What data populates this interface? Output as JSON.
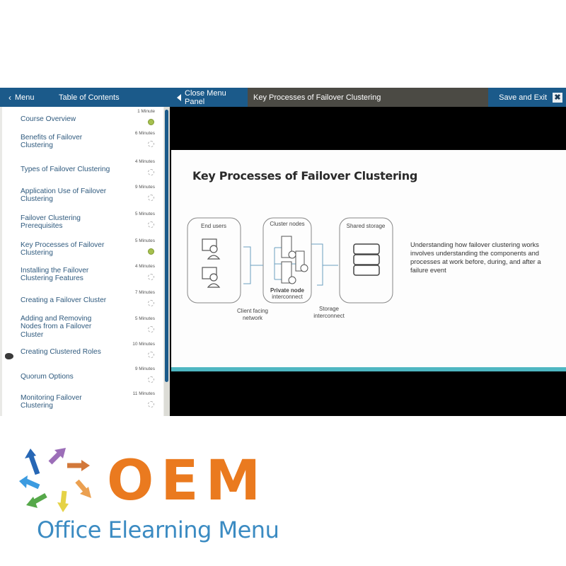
{
  "topbar": {
    "menu_label": "Menu",
    "toc_label": "Table of Contents",
    "close_panel_label": "Close Menu Panel",
    "lesson_title": "Key Processes of Failover Clustering",
    "save_exit_label": "Save and Exit",
    "close_icon_glyph": "✖"
  },
  "toc": {
    "current_index": 5,
    "items": [
      {
        "label": "Course Overview",
        "duration": "1 Minute",
        "status": "complete"
      },
      {
        "label": "Benefits of Failover Clustering",
        "duration": "6 Minutes",
        "status": "not-started"
      },
      {
        "label": "Types of Failover Clustering",
        "duration": "4 Minutes",
        "status": "not-started"
      },
      {
        "label": "Application Use of Failover Clustering",
        "duration": "9 Minutes",
        "status": "not-started"
      },
      {
        "label": "Failover Clustering Prerequisites",
        "duration": "5 Minutes",
        "status": "not-started"
      },
      {
        "label": "Key Processes of Failover Clustering",
        "duration": "5 Minutes",
        "status": "complete"
      },
      {
        "label": "Installing the Failover Clustering Features",
        "duration": "4 Minutes",
        "status": "not-started"
      },
      {
        "label": "Creating a Failover Cluster",
        "duration": "7 Minutes",
        "status": "not-started"
      },
      {
        "label": "Adding and Removing Nodes from a Failover Cluster",
        "duration": "5 Minutes",
        "status": "not-started"
      },
      {
        "label": "Creating Clustered Roles",
        "duration": "10 Minutes",
        "status": "not-started"
      },
      {
        "label": "Quorum Options",
        "duration": "9 Minutes",
        "status": "not-started"
      },
      {
        "label": "Monitoring Failover Clustering",
        "duration": "11 Minutes",
        "status": "not-started"
      }
    ]
  },
  "slide": {
    "title": "Key Processes of Failover Clustering",
    "diagram": {
      "end_users": "End users",
      "cluster_nodes": "Cluster nodes",
      "shared_storage": "Shared storage",
      "private_node_1": "Private node",
      "private_node_2": "interconnect",
      "client_facing_1": "Client facing",
      "client_facing_2": "network",
      "storage_1": "Storage",
      "storage_2": "interconnect"
    },
    "description": "Understanding how failover clustering works involves understanding the components and processes at work before, during, and after a failure event"
  },
  "logo": {
    "acronym": "OEM",
    "name": "Office Elearning Menu"
  },
  "colors": {
    "header_blue": "#1b5a8a",
    "title_bar_gray": "#4b4a44",
    "complete_green": "#a6c04e",
    "slide_accent_teal": "#4fb7c2",
    "logo_orange": "#ea7a1f",
    "logo_blue": "#3b8bc2"
  }
}
